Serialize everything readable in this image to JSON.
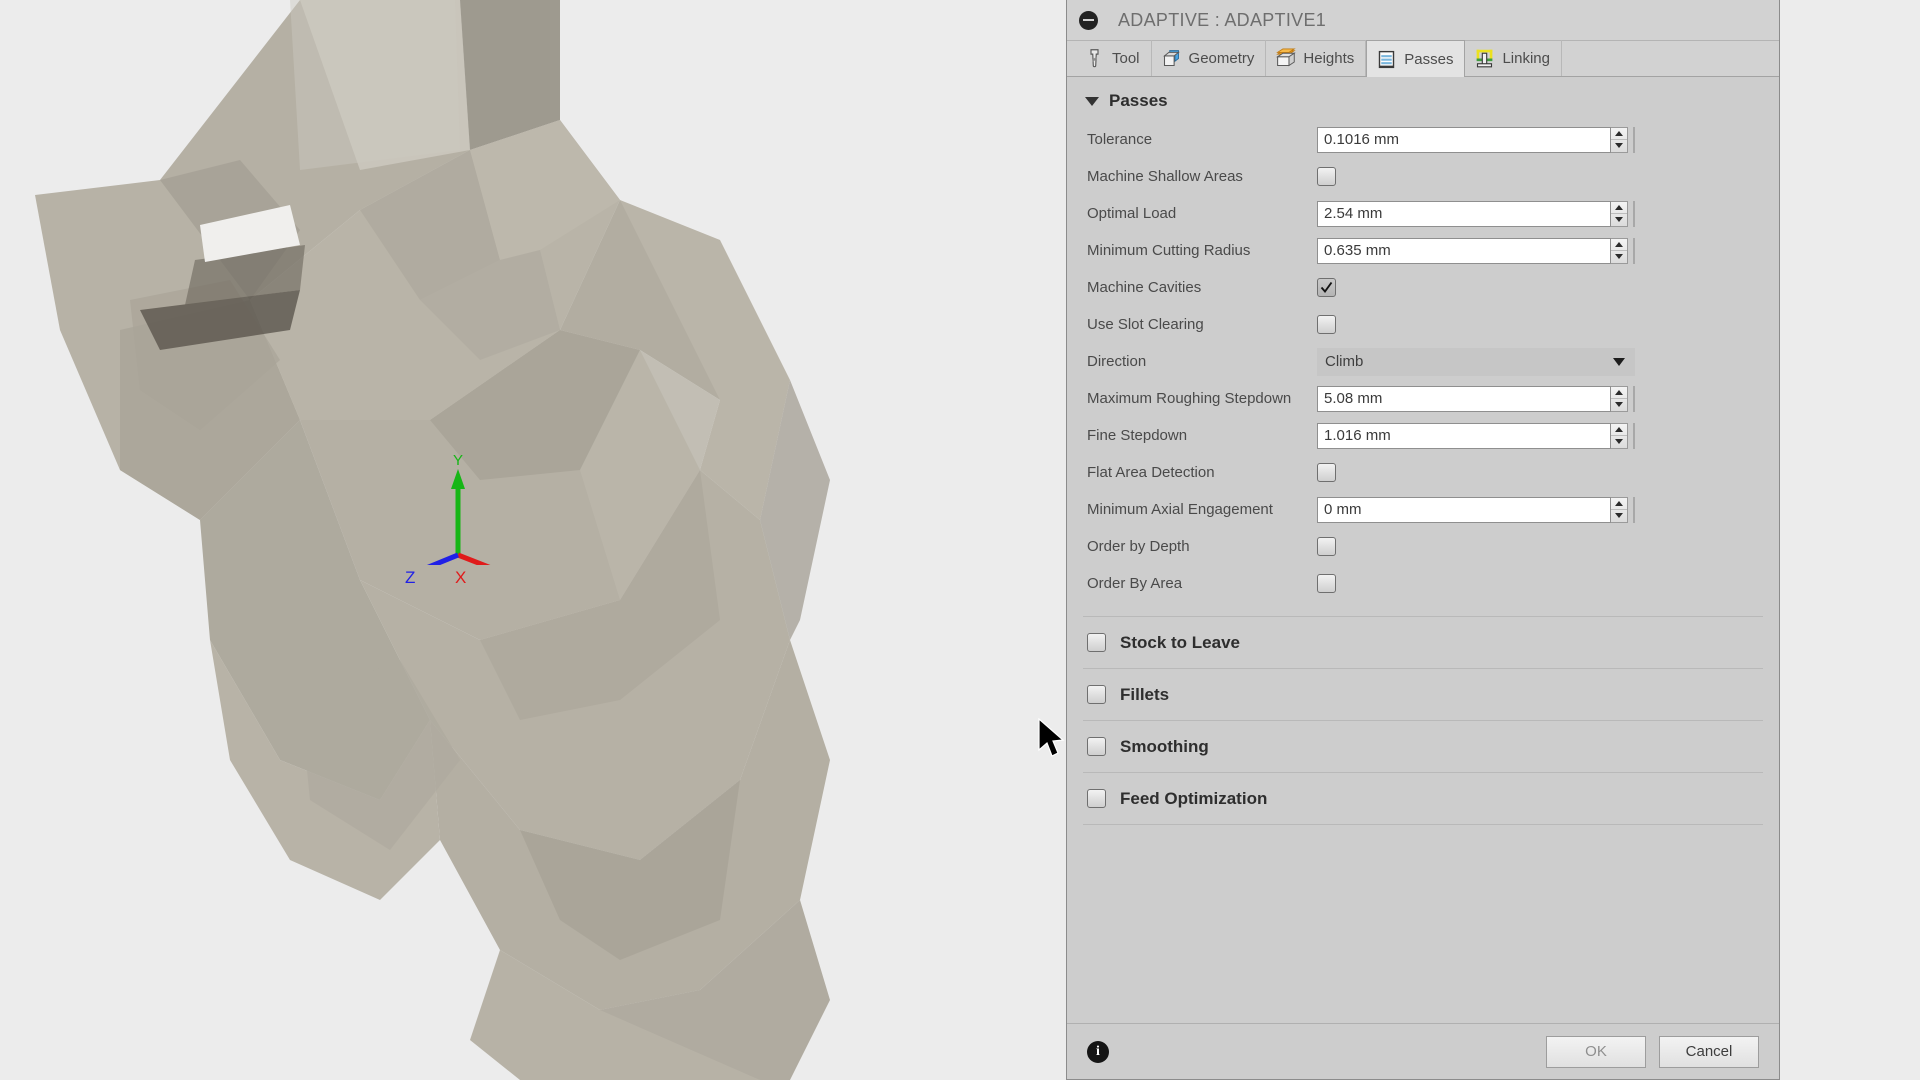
{
  "window": {
    "title": "ADAPTIVE : ADAPTIVE1",
    "collapse_icon": "collapse-minus-icon"
  },
  "tabs": [
    {
      "label": "Tool",
      "icon": "tool-icon",
      "active": false
    },
    {
      "label": "Geometry",
      "icon": "geometry-icon",
      "active": false
    },
    {
      "label": "Heights",
      "icon": "heights-icon",
      "active": false
    },
    {
      "label": "Passes",
      "icon": "passes-icon",
      "active": true
    },
    {
      "label": "Linking",
      "icon": "linking-icon",
      "active": false
    }
  ],
  "passes": {
    "section_title": "Passes",
    "rows": [
      {
        "label": "Tolerance",
        "type": "number",
        "value": "0.1016 mm"
      },
      {
        "label": "Machine Shallow Areas",
        "type": "checkbox",
        "checked": false
      },
      {
        "label": "Optimal Load",
        "type": "number",
        "value": "2.54 mm"
      },
      {
        "label": "Minimum Cutting Radius",
        "type": "number",
        "value": "0.635 mm"
      },
      {
        "label": "Machine Cavities",
        "type": "checkbox",
        "checked": true
      },
      {
        "label": "Use Slot Clearing",
        "type": "checkbox",
        "checked": false
      },
      {
        "label": "Direction",
        "type": "select",
        "value": "Climb"
      },
      {
        "label": "Maximum Roughing Stepdown",
        "type": "number",
        "value": "5.08 mm"
      },
      {
        "label": "Fine Stepdown",
        "type": "number",
        "value": "1.016 mm"
      },
      {
        "label": "Flat Area Detection",
        "type": "checkbox",
        "checked": false
      },
      {
        "label": "Minimum Axial Engagement",
        "type": "number",
        "value": "0 mm"
      },
      {
        "label": "Order by Depth",
        "type": "checkbox",
        "checked": false
      },
      {
        "label": "Order By Area",
        "type": "checkbox",
        "checked": false
      }
    ]
  },
  "groups": [
    {
      "label": "Stock to Leave",
      "checked": false
    },
    {
      "label": "Fillets",
      "checked": false
    },
    {
      "label": "Smoothing",
      "checked": false
    },
    {
      "label": "Feed Optimization",
      "checked": false
    }
  ],
  "footer": {
    "info_icon": "info-icon",
    "ok_label": "OK",
    "cancel_label": "Cancel"
  },
  "viewport": {
    "axes": [
      {
        "label": "Y",
        "color": "#16b616"
      },
      {
        "label": "X",
        "color": "#e01b1b"
      },
      {
        "label": "Z",
        "color": "#2020e6"
      }
    ],
    "model_color": "#b5b0a4",
    "background_color": "#ececec"
  },
  "colors": {
    "panel_bg": "#cdcdcd",
    "titlebar_bg": "#d2d2d2",
    "active_tab_bg": "#e3e3e3",
    "field_bg": "#ffffff",
    "border": "#8f8f8f"
  }
}
